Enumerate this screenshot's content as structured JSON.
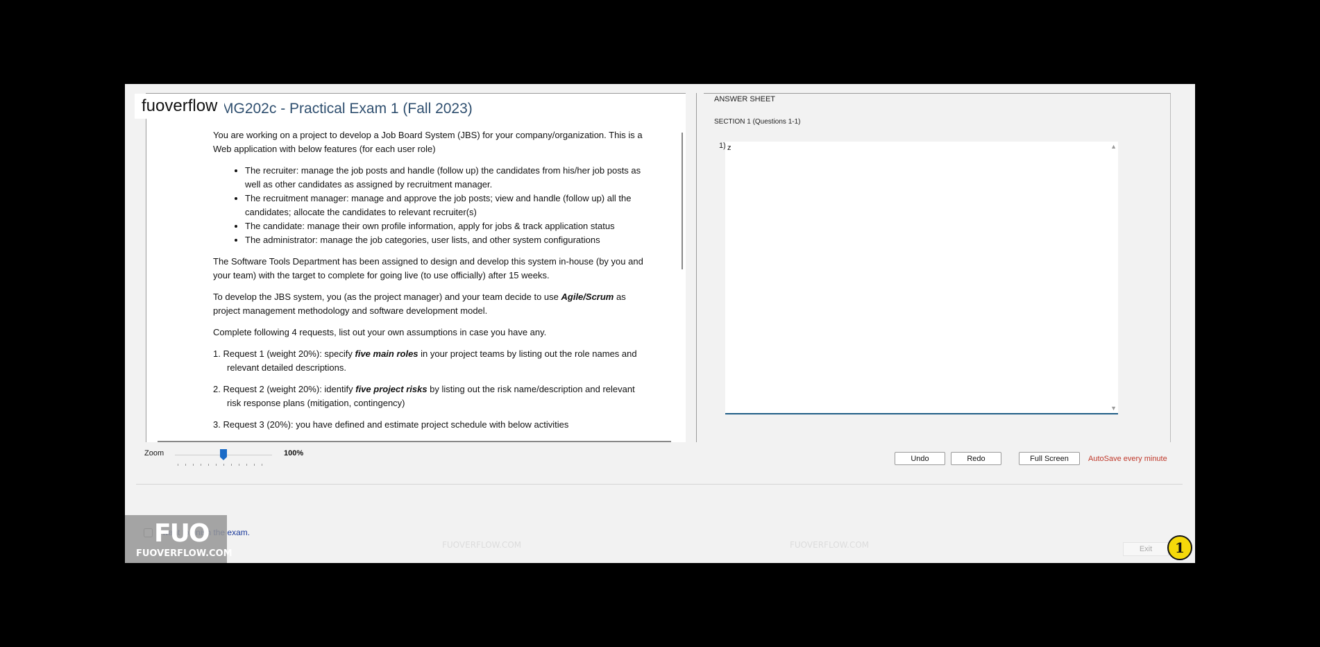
{
  "watermark": {
    "brand": "fuoverflow",
    "logo_big": "FUO",
    "logo_small": "FUOVERFLOW.COM",
    "text": "FUOVERFLOW.COM"
  },
  "exam": {
    "title": "MG202c - Practical Exam 1 (Fall 2023)",
    "intro": "You are working on a project to develop a Job Board System (JBS) for your company/organization. This is a Web application with below features (for each user role)",
    "roles": [
      "The recruiter: manage the job posts and handle (follow up) the candidates from his/her job posts as well as other candidates as assigned by recruitment manager.",
      "The recruitment manager: manage and approve the job posts; view and handle (follow up) all the candidates; allocate the candidates to relevant recruiter(s)",
      "The candidate: manage their own profile information, apply for jobs & track application status",
      "The administrator: manage the job categories, user lists, and other system configurations"
    ],
    "para2": "The Software Tools Department has been assigned to design and develop this system in-house (by you and your team) with the target to complete for going live (to use officially) after 15 weeks.",
    "para3_pre": "To develop the JBS system, you (as the project manager) and your team decide to use ",
    "para3_em": "Agile/Scrum",
    "para3_post": " as project management methodology and software development model.",
    "para4": "Complete following 4 requests, list out your own assumptions in case you have any.",
    "requests": [
      {
        "pre": "1. Request 1 (weight 20%): specify ",
        "em": "five main roles",
        "post": " in your project teams by listing out the role names and relevant detailed descriptions."
      },
      {
        "pre": "2. Request 2 (weight 20%): identify ",
        "em": "five project risks",
        "post": " by listing out the risk name/description and relevant risk response plans (mitigation, contingency)"
      },
      {
        "pre": "3. Request 3 (20%): you have defined and estimate project schedule with below activities",
        "em": "",
        "post": ""
      }
    ]
  },
  "zoom": {
    "label": "Zoom",
    "value": "100%",
    "level_percent": 100
  },
  "answer": {
    "header": "ANSWER SHEET",
    "section": "SECTION 1 (Questions 1-1)",
    "question_number": "1)",
    "answer_text": "z"
  },
  "buttons": {
    "undo": "Undo",
    "redo": "Redo",
    "fullscreen": "Full Screen",
    "autosave": "AutoSave every minute",
    "exit": "Exit"
  },
  "finish": {
    "label": "I want to finish the exam."
  },
  "badge": {
    "number": "1",
    "color": "#f5d90a"
  }
}
